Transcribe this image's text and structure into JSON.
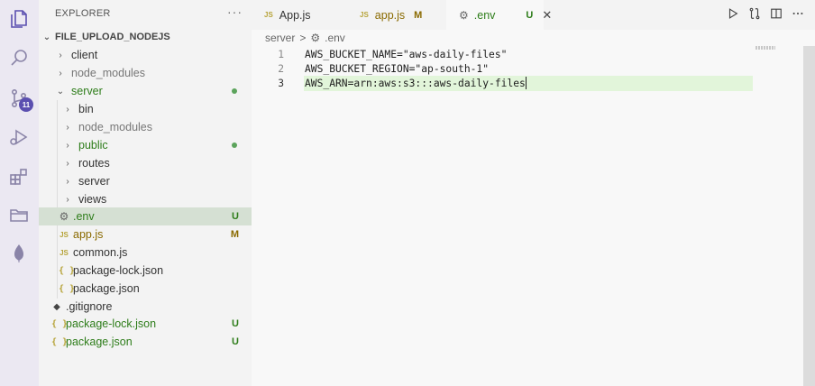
{
  "activity_bar": {
    "icons": [
      "explorer-icon",
      "search-icon",
      "source-control-icon",
      "run-debug-icon",
      "extensions-icon",
      "folder-icon",
      "mongodb-leaf-icon"
    ],
    "source_control_badge": "11"
  },
  "sidebar": {
    "header": "EXPLORER",
    "more": "···",
    "section_title": "FILE_UPLOAD_NODEJS",
    "items": [
      {
        "label": "client",
        "type": "folder",
        "expanded": false,
        "status": ""
      },
      {
        "label": "node_modules",
        "type": "folder",
        "expanded": false,
        "status": ""
      },
      {
        "label": "server",
        "type": "folder",
        "expanded": true,
        "status": "dot"
      },
      {
        "label": "bin",
        "type": "folder",
        "expanded": false,
        "status": ""
      },
      {
        "label": "node_modules",
        "type": "folder",
        "expanded": false,
        "status": ""
      },
      {
        "label": "public",
        "type": "folder",
        "expanded": false,
        "status": "dot"
      },
      {
        "label": "routes",
        "type": "folder",
        "expanded": false,
        "status": ""
      },
      {
        "label": "server",
        "type": "folder",
        "expanded": false,
        "status": ""
      },
      {
        "label": "views",
        "type": "folder",
        "expanded": false,
        "status": ""
      },
      {
        "label": ".env",
        "type": "file",
        "status": "U"
      },
      {
        "label": "app.js",
        "type": "file",
        "status": "M"
      },
      {
        "label": "common.js",
        "type": "file",
        "status": ""
      },
      {
        "label": "package-lock.json",
        "type": "file",
        "status": ""
      },
      {
        "label": "package.json",
        "type": "file",
        "status": ""
      },
      {
        "label": ".gitignore",
        "type": "file",
        "status": ""
      },
      {
        "label": "package-lock.json",
        "type": "file",
        "status": "U"
      },
      {
        "label": "package.json",
        "type": "file",
        "status": "U"
      }
    ],
    "js_label": "JS",
    "brace_label": "{ }"
  },
  "tabs": [
    {
      "label": "App.js",
      "icon": "JS",
      "status": ""
    },
    {
      "label": "app.js",
      "icon": "JS",
      "status": "M"
    },
    {
      "label": ".env",
      "icon": "gear",
      "status": "U",
      "active": true
    }
  ],
  "breadcrumb": {
    "folder": "server",
    "separator": ">",
    "file": ".env"
  },
  "editor": {
    "lines": [
      {
        "number": "1",
        "text": "AWS_BUCKET_NAME=\"aws-daily-files\""
      },
      {
        "number": "2",
        "text": "AWS_BUCKET_REGION=\"ap-south-1\""
      },
      {
        "number": "3",
        "text": "AWS_ARN=arn:aws:s3:::aws-daily-files"
      }
    ],
    "current_line": 3
  },
  "colors": {
    "activity_bar_bg": "#ebe8f2",
    "sidebar_bg": "#f3f3f3",
    "selection_bg": "#d5e0d3",
    "current_line_bg": "#e2f5da",
    "untracked_green": "#2e7d1a",
    "modified_yellow": "#8a6a00",
    "badge_purple": "#5b4fb0"
  }
}
